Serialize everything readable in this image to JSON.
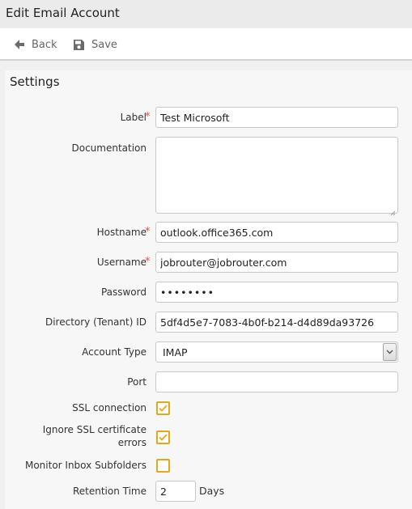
{
  "window": {
    "title": "Edit Email Account"
  },
  "toolbar": {
    "back_label": "Back",
    "save_label": "Save"
  },
  "panel": {
    "title": "Settings"
  },
  "form": {
    "label": {
      "label": "Label",
      "required": "*",
      "value": "Test Microsoft"
    },
    "documentation": {
      "label": "Documentation",
      "value": ""
    },
    "hostname": {
      "label": "Hostname",
      "required": "*",
      "value": "outlook.office365.com"
    },
    "username": {
      "label": "Username",
      "required": "*",
      "value": "jobrouter@jobrouter.com"
    },
    "password": {
      "label": "Password",
      "value": "••••••••"
    },
    "tenant_id": {
      "label": "Directory (Tenant) ID",
      "value": "5df4d5e7-7083-4b0f-b214-d4d89da93726"
    },
    "account_type": {
      "label": "Account Type",
      "value": "IMAP"
    },
    "port": {
      "label": "Port",
      "value": ""
    },
    "ssl_connection": {
      "label": "SSL connection",
      "checked": true
    },
    "ignore_ssl_errors": {
      "label": "Ignore SSL certificate errors",
      "checked": true
    },
    "monitor_subfolders": {
      "label": "Monitor Inbox Subfolders",
      "checked": false
    },
    "retention_time": {
      "label": "Retention Time",
      "value": "2",
      "unit": "Days"
    }
  },
  "colors": {
    "checkbox_accent": "#e6a817",
    "required_marker": "#d9534f"
  },
  "icons": {
    "back": "arrow-left-icon",
    "save": "floppy-disk-icon",
    "dropdown": "chevron-down-icon",
    "check": "checkmark-icon"
  }
}
